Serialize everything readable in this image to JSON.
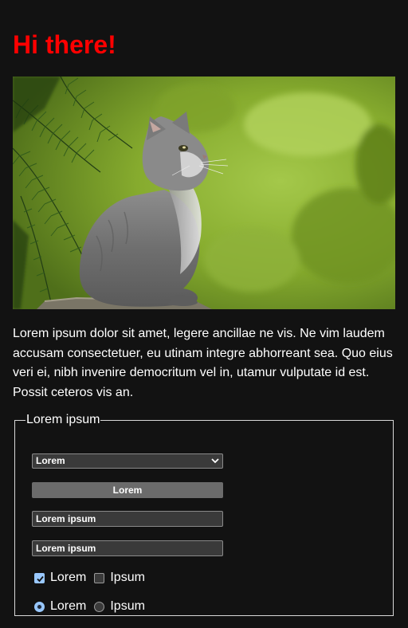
{
  "heading": "Hi there!",
  "hero_image": {
    "subject": "gray kitten sitting on a rock, looking up, with pine branches and a green blurred background",
    "icon": "kitten-photo"
  },
  "intro_text": "Lorem ipsum dolor sit amet, legere ancillae ne vis. Ne vim laudem accusam consectetuer, eu utinam integre abhorreant sea. Quo eius veri ei, nibh invenire democritum vel in, utamur vulputate id est. Possit ceteros vis an.",
  "form": {
    "legend": "Lorem ipsum",
    "select": {
      "selected": "Lorem"
    },
    "button_label": "Lorem",
    "text_input_1": {
      "value": "Lorem ipsum"
    },
    "text_input_2": {
      "value": "Lorem ipsum"
    },
    "checkboxes": [
      {
        "label": "Lorem",
        "checked": true
      },
      {
        "label": "Ipsum",
        "checked": false
      }
    ],
    "radios": [
      {
        "label": "Lorem",
        "selected": true
      },
      {
        "label": "Ipsum",
        "selected": false
      }
    ]
  },
  "colors": {
    "background": "#121212",
    "heading": "#ff0000",
    "accent": "#99c8ff",
    "control_bg": "#3a3a3a",
    "button_bg": "#6b6b6b"
  }
}
